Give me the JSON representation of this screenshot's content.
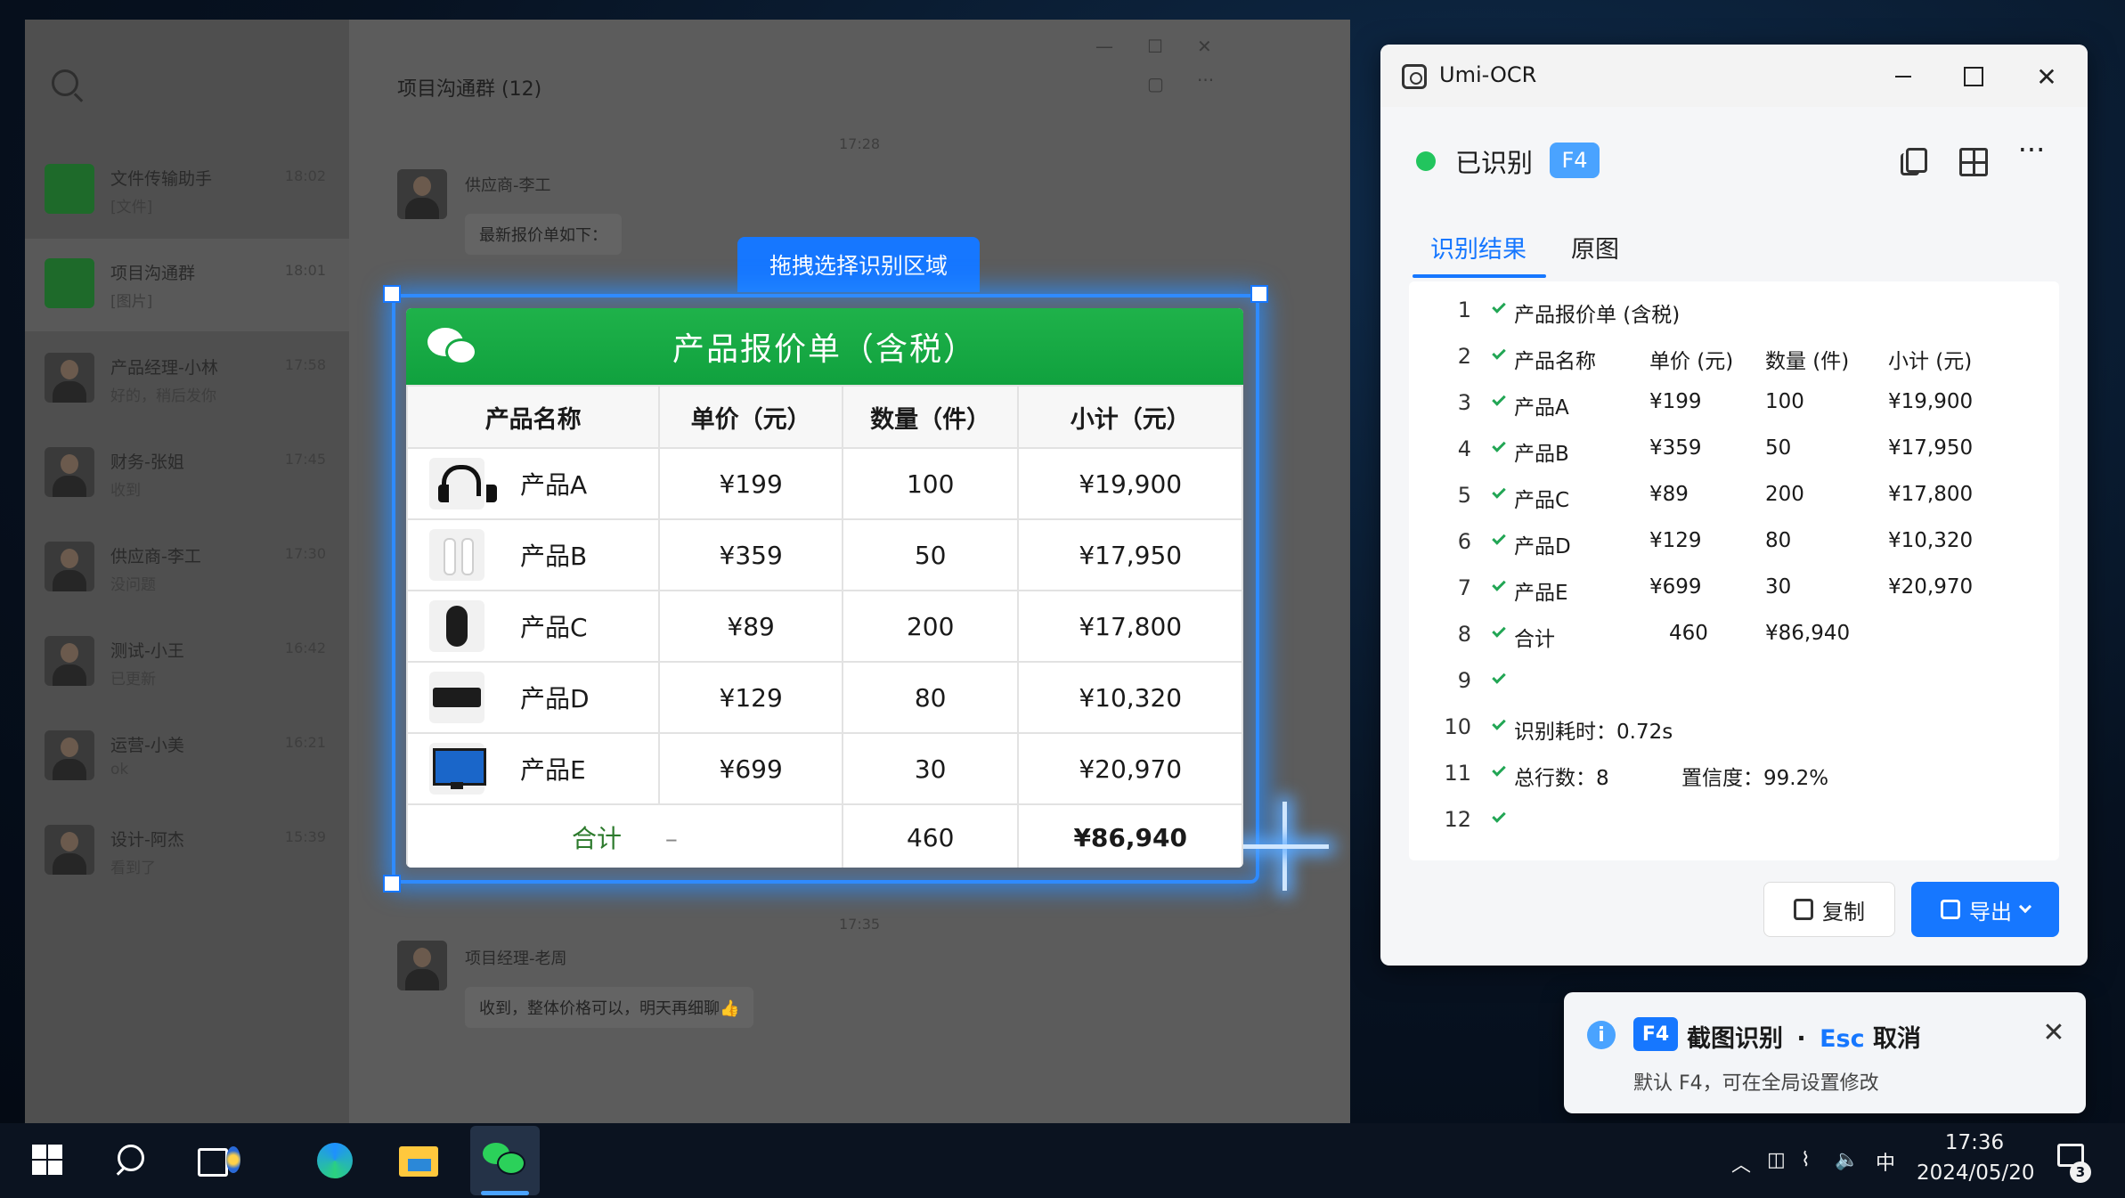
{
  "wechat": {
    "title": "项目沟通群 (12)",
    "chats": [
      {
        "name": "文件传输助手",
        "preview": "[文件]",
        "time": "18:02"
      },
      {
        "name": "项目沟通群",
        "preview": "[图片]",
        "time": "18:01"
      },
      {
        "name": "产品经理-小林",
        "preview": "好的，稍后发你",
        "time": "17:58"
      },
      {
        "name": "财务-张姐",
        "preview": "收到",
        "time": "17:45"
      },
      {
        "name": "供应商-李工",
        "preview": "没问题",
        "time": "17:30"
      },
      {
        "name": "测试-小王",
        "preview": "已更新",
        "time": "16:42"
      },
      {
        "name": "运营-小美",
        "preview": "ok",
        "time": "16:21"
      },
      {
        "name": "设计-阿杰",
        "preview": "看到了",
        "time": "15:39"
      }
    ],
    "timestamps": [
      "17:28",
      "17:35"
    ],
    "messages": [
      {
        "sender": "供应商-李工",
        "text": "最新报价单如下："
      },
      {
        "sender": "项目经理-老周",
        "text": "收到，整体价格可以，明天再细聊👍"
      }
    ]
  },
  "selection": {
    "label": "拖拽选择识别区域"
  },
  "quote": {
    "title": "产品报价单（含税）",
    "headers": [
      "产品名称",
      "单价（元）",
      "数量（件）",
      "小计（元）"
    ],
    "rows": [
      {
        "icon": "headphones-icon",
        "name": "产品A",
        "price": "¥199",
        "qty": "100",
        "subtotal": "¥19,900"
      },
      {
        "icon": "earbuds-icon",
        "name": "产品B",
        "price": "¥359",
        "qty": "50",
        "subtotal": "¥17,950"
      },
      {
        "icon": "mouse-icon",
        "name": "产品C",
        "price": "¥89",
        "qty": "200",
        "subtotal": "¥17,800"
      },
      {
        "icon": "keyboard-icon",
        "name": "产品D",
        "price": "¥129",
        "qty": "80",
        "subtotal": "¥10,320"
      },
      {
        "icon": "monitor-icon",
        "name": "产品E",
        "price": "¥699",
        "qty": "30",
        "subtotal": "¥20,970"
      }
    ],
    "total": {
      "label": "合计",
      "dash": "–",
      "qty": "460",
      "amount": "¥86,940"
    }
  },
  "ocr": {
    "app_title": "Umi-OCR",
    "status": "已识别",
    "hotkey": "F4",
    "tabs": [
      "识别结果",
      "原图"
    ],
    "lines": [
      {
        "n": "1",
        "cells": [
          "产品报价单 (含税)"
        ]
      },
      {
        "n": "2",
        "cells": [
          "产品名称",
          "单价 (元)",
          "数量 (件)",
          "小计 (元)"
        ]
      },
      {
        "n": "3",
        "cells": [
          "产品A",
          "¥199",
          "100",
          "¥19,900"
        ]
      },
      {
        "n": "4",
        "cells": [
          "产品B",
          "¥359",
          "50",
          "¥17,950"
        ]
      },
      {
        "n": "5",
        "cells": [
          "产品C",
          "¥89",
          "200",
          "¥17,800"
        ]
      },
      {
        "n": "6",
        "cells": [
          "产品D",
          "¥129",
          "80",
          "¥10,320"
        ]
      },
      {
        "n": "7",
        "cells": [
          "产品E",
          "¥699",
          "30",
          "¥20,970"
        ]
      },
      {
        "n": "8",
        "cells": [
          "合计",
          "460",
          "¥86,940"
        ]
      },
      {
        "n": "9",
        "cells": []
      },
      {
        "n": "10",
        "cells": [
          "识别耗时：0.72s"
        ]
      },
      {
        "n": "11",
        "cells": [
          "总行数：8",
          "置信度：99.2%"
        ]
      },
      {
        "n": "12",
        "cells": []
      }
    ],
    "copy_label": "复制",
    "export_label": "导出"
  },
  "toast": {
    "key": "F4",
    "action": "截图识别",
    "sep": "·",
    "esc": "Esc",
    "cancel": "取消",
    "hint": "默认 F4，可在全局设置修改"
  },
  "taskbar": {
    "time": "17:36",
    "date": "2024/05/20",
    "ime": "中",
    "notifications": "3"
  }
}
